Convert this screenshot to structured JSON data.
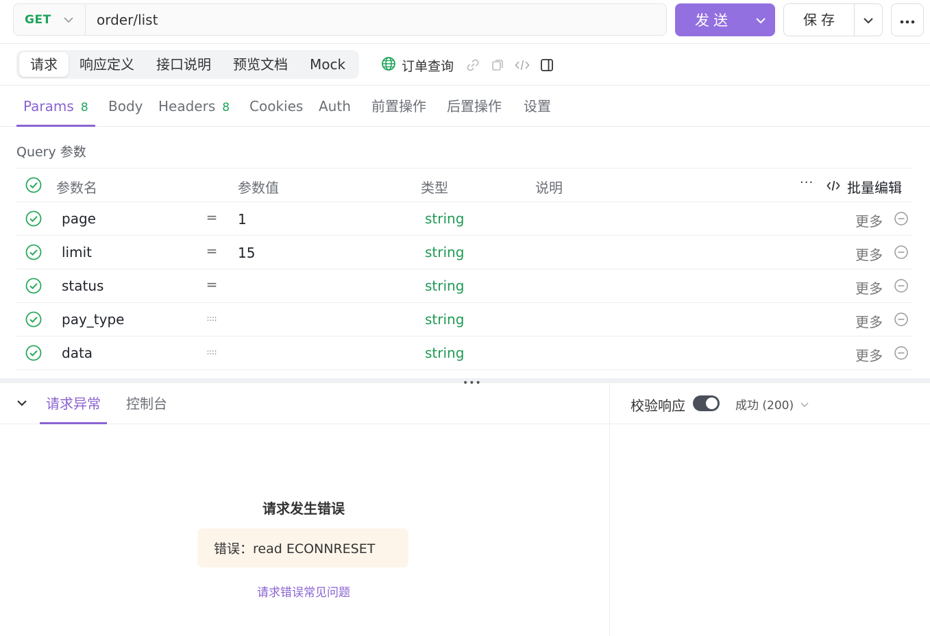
{
  "request": {
    "method": "GET",
    "url": "order/list",
    "send_label": "发送",
    "save_label": "保存"
  },
  "segments": {
    "tabs": [
      {
        "label": "请求",
        "active": true
      },
      {
        "label": "响应定义"
      },
      {
        "label": "接口说明"
      },
      {
        "label": "预览文档"
      },
      {
        "label": "Mock"
      }
    ],
    "api_name": "订单查询"
  },
  "param_tabs": [
    {
      "label": "Params",
      "badge": "8",
      "active": true
    },
    {
      "label": "Body"
    },
    {
      "label": "Headers",
      "badge": "8"
    },
    {
      "label": "Cookies"
    },
    {
      "label": "Auth"
    },
    {
      "label": "前置操作"
    },
    {
      "label": "后置操作"
    },
    {
      "label": "设置"
    }
  ],
  "query": {
    "title": "Query 参数",
    "headers": {
      "name": "参数名",
      "value": "参数值",
      "type": "类型",
      "desc": "说明",
      "bulk_edit": "批量编辑"
    },
    "rows": [
      {
        "name": "page",
        "op": "=",
        "value": "1",
        "type": "string",
        "more": "更多"
      },
      {
        "name": "limit",
        "op": "=",
        "value": "15",
        "type": "string",
        "more": "更多"
      },
      {
        "name": "status",
        "op": "=",
        "value": "",
        "type": "string",
        "more": "更多"
      },
      {
        "name": "pay_type",
        "op": "::::",
        "value": "",
        "type": "string",
        "more": "更多"
      },
      {
        "name": "data",
        "op": "::::",
        "value": "",
        "type": "string",
        "more": "更多"
      }
    ]
  },
  "bottom": {
    "tabs": [
      {
        "label": "请求异常",
        "active": true
      },
      {
        "label": "控制台"
      }
    ],
    "error_title": "请求发生错误",
    "error_message": "错误：read ECONNRESET",
    "error_link": "请求错误常见问题",
    "validate_label": "校验响应",
    "validate_on": true,
    "status_label": "成功 (200)"
  },
  "colors": {
    "accent": "#8a63d2",
    "send_button": "#9370e0",
    "method_get": "#1fa35a",
    "type_string": "#1f9a55",
    "error_bg": "#fdf5ea"
  }
}
